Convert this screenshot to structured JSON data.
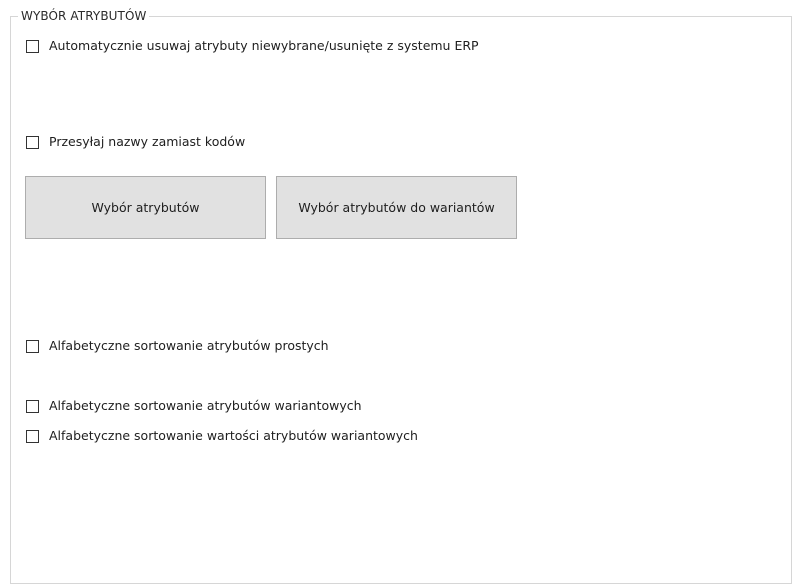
{
  "group": {
    "title": "WYBÓR ATRYBUTÓW"
  },
  "checkboxes": [
    {
      "label": "Automatycznie usuwaj atrybuty niewybrane/usunięte z systemu ERP",
      "checked": false
    },
    {
      "label": "Przesyłaj nazwy zamiast kodów",
      "checked": false
    },
    {
      "label": "Alfabetyczne sortowanie atrybutów prostych",
      "checked": false
    },
    {
      "label": "Alfabetyczne sortowanie atrybutów wariantowych",
      "checked": false
    },
    {
      "label": "Alfabetyczne sortowanie wartości atrybutów wariantowych",
      "checked": false
    }
  ],
  "buttons": {
    "select_attributes": "Wybór atrybutów",
    "select_variant_attributes": "Wybór atrybutów do wariantów"
  }
}
